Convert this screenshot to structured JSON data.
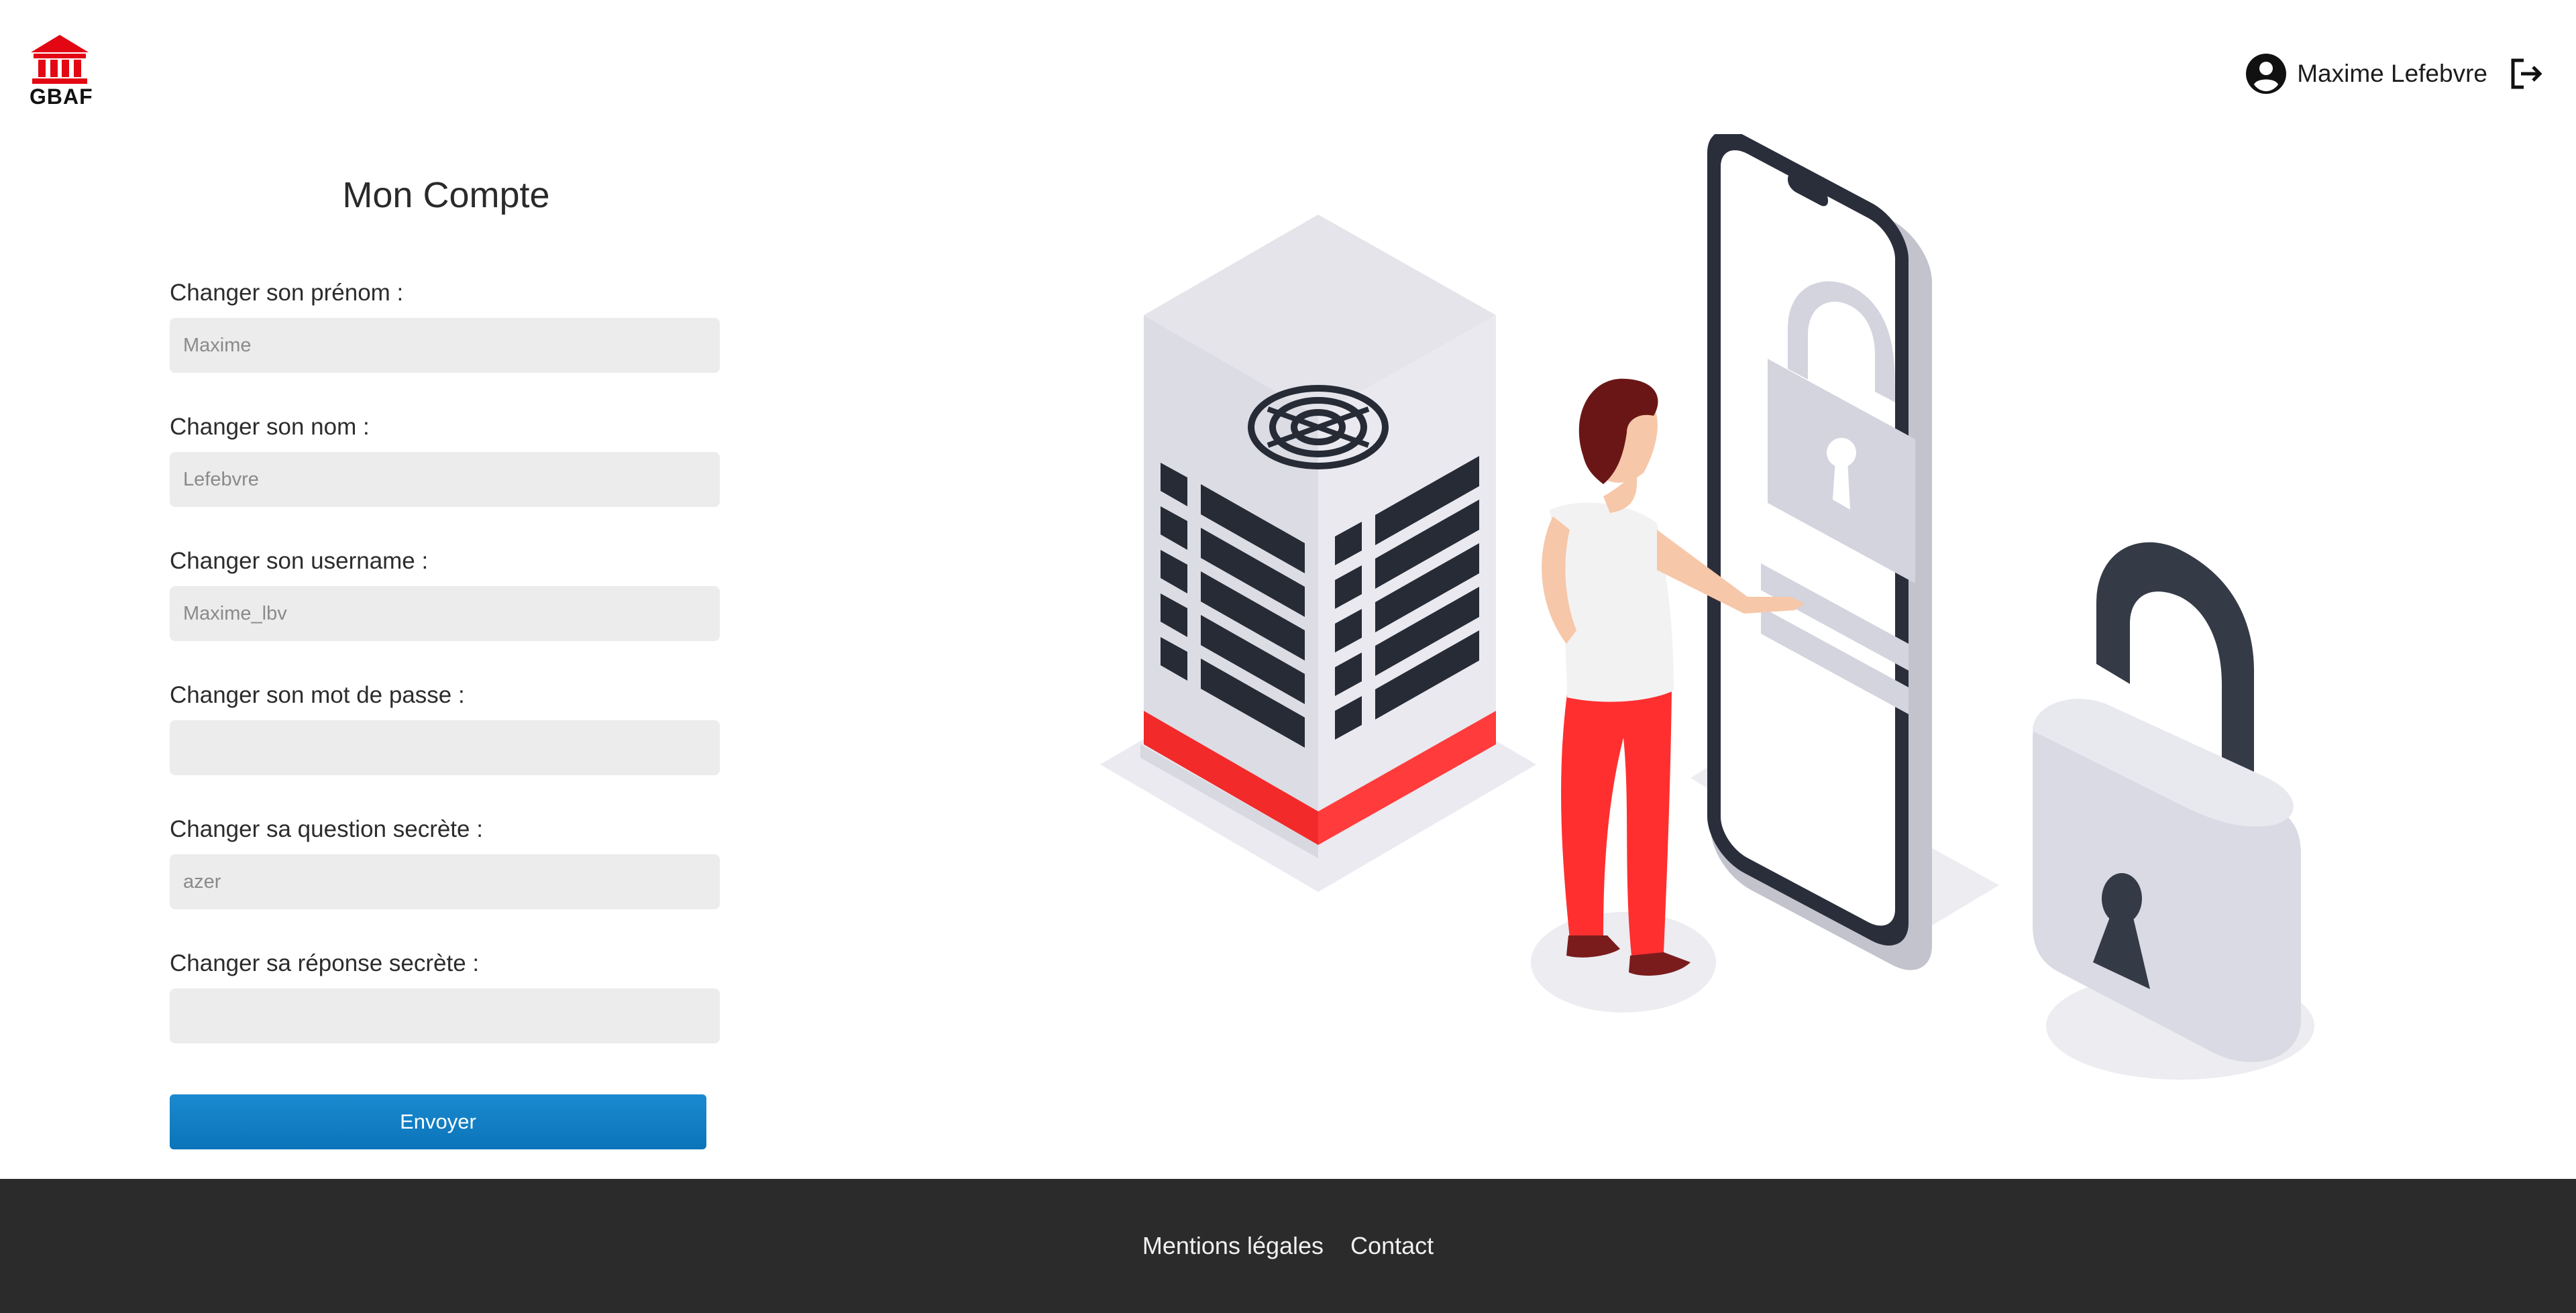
{
  "brand": {
    "logo_text": "GBAF",
    "accent_color": "#e30613"
  },
  "header": {
    "user_name": "Maxime Lefebvre",
    "user_icon": "account-circle-icon",
    "logout_icon": "logout-icon"
  },
  "form": {
    "title": "Mon Compte",
    "fields": [
      {
        "label": "Changer son prénom :",
        "placeholder": "Maxime"
      },
      {
        "label": "Changer son nom :",
        "placeholder": "Lefebvre"
      },
      {
        "label": "Changer son username :",
        "placeholder": "Maxime_lbv"
      },
      {
        "label": "Changer son mot de passe :",
        "placeholder": ""
      },
      {
        "label": "Changer sa question secrète :",
        "placeholder": "azer"
      },
      {
        "label": "Changer sa réponse secrète :",
        "placeholder": ""
      }
    ],
    "submit_label": "Envoyer",
    "submit_color": "#0b7cc1"
  },
  "footer": {
    "links": [
      "Mentions légales",
      "Contact"
    ],
    "background": "#2b2b2b"
  }
}
